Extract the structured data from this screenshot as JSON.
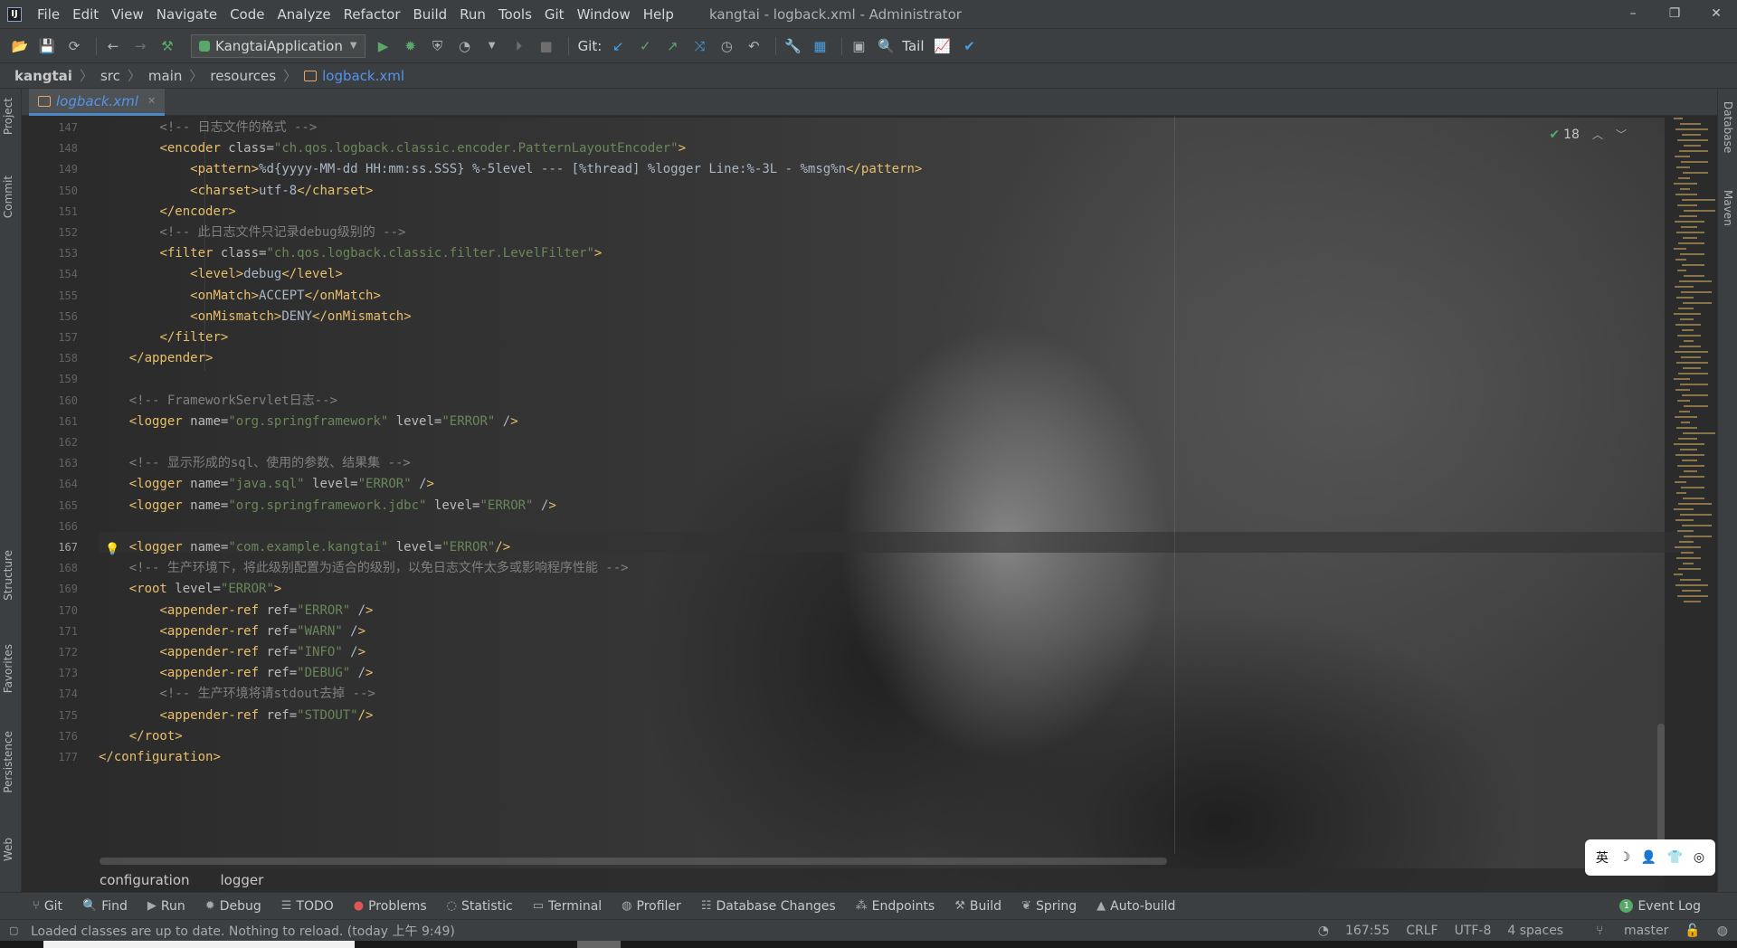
{
  "menubar": {
    "logo": "IJ",
    "items": [
      "File",
      "Edit",
      "View",
      "Navigate",
      "Code",
      "Analyze",
      "Refactor",
      "Build",
      "Run",
      "Tools",
      "Git",
      "Window",
      "Help"
    ],
    "window_title": "kangtai - logback.xml - Administrator",
    "controls": {
      "minimize": "–",
      "restore": "❐",
      "close": "✕"
    }
  },
  "toolbar": {
    "run_config": "KangtaiApplication",
    "git_label": "Git:",
    "tail_label": "Tail"
  },
  "breadcrumbs": [
    "kangtai",
    "src",
    "main",
    "resources",
    "logback.xml"
  ],
  "tabs": [
    {
      "label": "logback.xml",
      "close": "✕"
    }
  ],
  "side_tabs": {
    "left": [
      "Project",
      "Commit",
      "Structure",
      "Favorites",
      "Persistence",
      "Web"
    ],
    "right": [
      "Database",
      "Maven"
    ]
  },
  "inspection": {
    "count": "18"
  },
  "editor": {
    "line_numbers": [
      "147",
      "148",
      "149",
      "150",
      "151",
      "152",
      "153",
      "154",
      "155",
      "156",
      "157",
      "158",
      "159",
      "160",
      "161",
      "162",
      "163",
      "164",
      "165",
      "166",
      "167",
      "168",
      "169",
      "170",
      "171",
      "172",
      "173",
      "174",
      "175",
      "176",
      "177"
    ],
    "current_line": "167",
    "lines": [
      "        <!-- 日志文件的格式 -->",
      "        <encoder class=\"ch.qos.logback.classic.encoder.PatternLayoutEncoder\">",
      "            <pattern>%d{yyyy-MM-dd HH:mm:ss.SSS} %-5level --- [%thread] %logger Line:%-3L - %msg%n</pattern>",
      "            <charset>utf-8</charset>",
      "        </encoder>",
      "        <!-- 此日志文件只记录debug级别的 -->",
      "        <filter class=\"ch.qos.logback.classic.filter.LevelFilter\">",
      "            <level>debug</level>",
      "            <onMatch>ACCEPT</onMatch>",
      "            <onMismatch>DENY</onMismatch>",
      "        </filter>",
      "    </appender>",
      "",
      "    <!-- FrameworkServlet日志-->",
      "    <logger name=\"org.springframework\" level=\"ERROR\" />",
      "",
      "    <!-- 显示形成的sql、使用的参数、结果集 -->",
      "    <logger name=\"java.sql\" level=\"ERROR\" />",
      "    <logger name=\"org.springframework.jdbc\" level=\"ERROR\" />",
      "",
      "    <logger name=\"com.example.kangtai\" level=\"ERROR\"/>",
      "    <!-- 生产环境下，将此级别配置为适合的级别，以免日志文件太多或影响程序性能 -->",
      "    <root level=\"ERROR\">",
      "        <appender-ref ref=\"ERROR\" />",
      "        <appender-ref ref=\"WARN\" />",
      "        <appender-ref ref=\"INFO\" />",
      "        <appender-ref ref=\"DEBUG\" />",
      "        <!-- 生产环境将请stdout去掉 -->",
      "        <appender-ref ref=\"STDOUT\"/>",
      "    </root>",
      "</configuration>"
    ]
  },
  "structure_path": [
    "configuration",
    "logger"
  ],
  "ime": {
    "mode": "英",
    "moon": "☽",
    "person": "👤",
    "shirt": "👕"
  },
  "toolwindows": [
    {
      "icon": "git-icon",
      "label": "Git"
    },
    {
      "icon": "search-icon",
      "label": "Find"
    },
    {
      "icon": "run-icon",
      "label": "Run"
    },
    {
      "icon": "debug-icon",
      "label": "Debug"
    },
    {
      "icon": "todo-icon",
      "label": "TODO"
    },
    {
      "icon": "problems-icon",
      "label": "Problems"
    },
    {
      "icon": "statistic-icon",
      "label": "Statistic"
    },
    {
      "icon": "terminal-icon",
      "label": "Terminal"
    },
    {
      "icon": "profiler-icon",
      "label": "Profiler"
    },
    {
      "icon": "database-changes-icon",
      "label": "Database Changes"
    },
    {
      "icon": "endpoints-icon",
      "label": "Endpoints"
    },
    {
      "icon": "build-icon",
      "label": "Build"
    },
    {
      "icon": "spring-icon",
      "label": "Spring"
    },
    {
      "icon": "auto-build-icon",
      "label": "Auto-build"
    }
  ],
  "event_log": {
    "badge": "1",
    "label": "Event Log"
  },
  "statusbar": {
    "message": "Loaded classes are up to date. Nothing to reload. (today 上午 9:49)",
    "position": "167:55",
    "line_ending": "CRLF",
    "encoding": "UTF-8",
    "indent": "4 spaces",
    "branch": "master"
  }
}
